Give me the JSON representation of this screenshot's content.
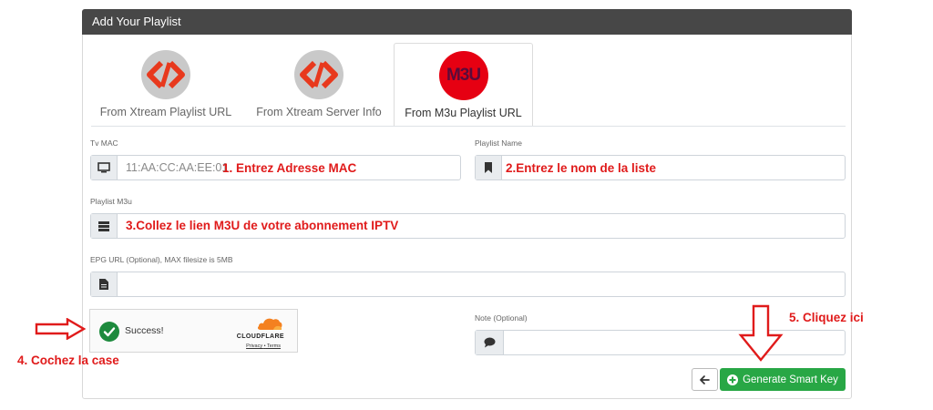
{
  "panel": {
    "title": "Add Your Playlist"
  },
  "tabs": [
    {
      "label": "From Xtream Playlist URL",
      "icon": "xtream-icon",
      "active": false
    },
    {
      "label": "From Xtream Server Info",
      "icon": "xtream-icon",
      "active": false
    },
    {
      "label": "From M3u Playlist URL",
      "icon": "m3u-icon",
      "logo_text": "M3U",
      "active": true
    }
  ],
  "form": {
    "tv_mac": {
      "label": "Tv MAC",
      "placeholder": "11:AA:CC:AA:EE:01",
      "icon": "monitor-icon"
    },
    "playlist_name": {
      "label": "Playlist Name",
      "placeholder": "",
      "icon": "bookmark-icon"
    },
    "playlist_m3u": {
      "label": "Playlist M3u",
      "placeholder": "",
      "icon": "server-icon"
    },
    "epg_url": {
      "label": "EPG URL (Optional), MAX filesize is 5MB",
      "placeholder": "",
      "icon": "file-icon"
    },
    "note": {
      "label": "Note (Optional)",
      "placeholder": "",
      "icon": "comment-icon"
    }
  },
  "captcha": {
    "status": "Success!",
    "brand": "CLOUDFLARE",
    "privacy": "Privacy",
    "separator": "•",
    "terms": "Terms"
  },
  "buttons": {
    "back_icon": "arrow-left-icon",
    "generate_label": "Generate Smart Key",
    "generate_icon": "plus-circle-icon"
  },
  "annotations": {
    "a1": "1.  Entrez Adresse MAC",
    "a2": "2.Entrez le nom de la liste",
    "a3": "3.Collez le lien M3U de votre abonnement IPTV",
    "a4": "4. Cochez la case",
    "a5": "5. Cliquez ici"
  },
  "colors": {
    "header_bg": "#474747",
    "accent_green": "#28a745",
    "annotation_red": "#e01b1b",
    "m3u_logo": "#e60012"
  }
}
